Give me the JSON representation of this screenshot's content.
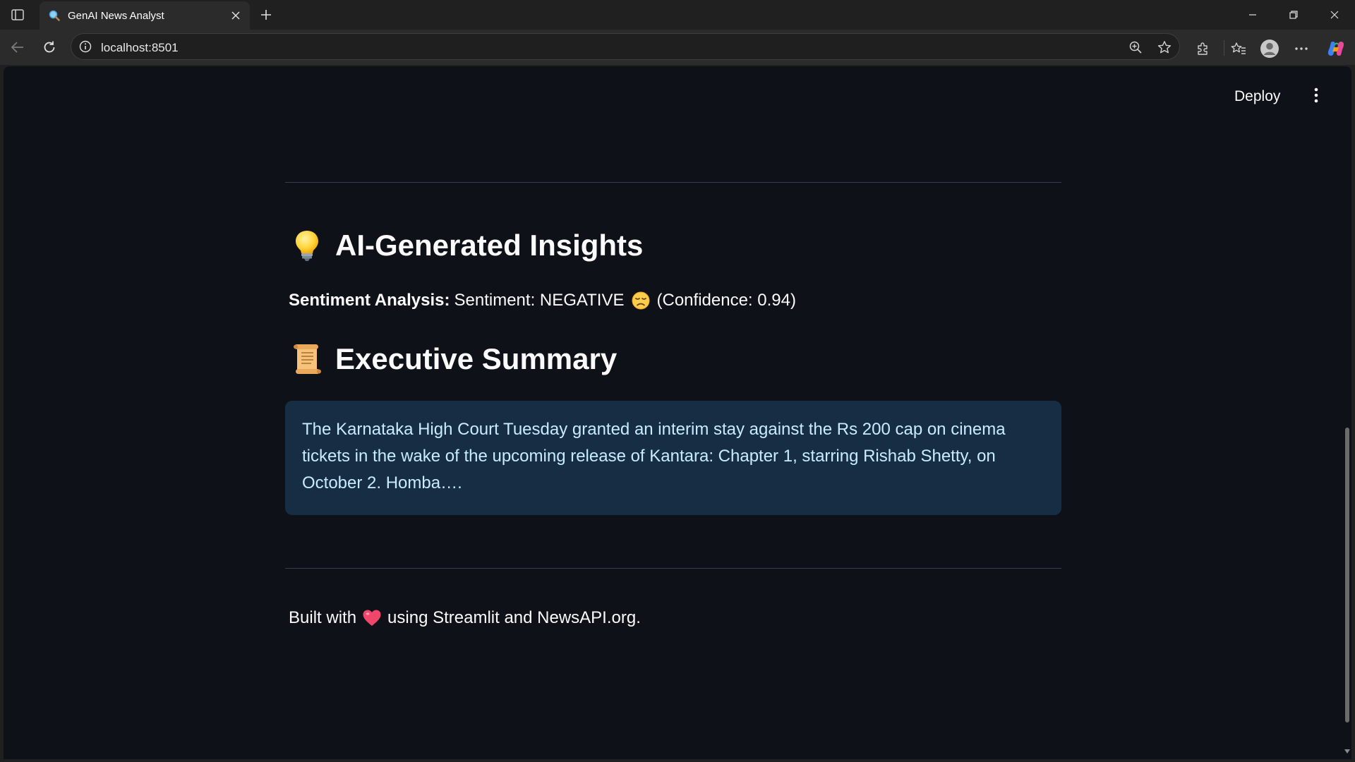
{
  "browser": {
    "tab_title": "GenAI News Analyst",
    "url": "localhost:8501"
  },
  "app": {
    "deploy_label": "Deploy",
    "insights_heading": "AI-Generated Insights",
    "insights_icon": "light-bulb-emoji",
    "sentiment": {
      "label": "Sentiment Analysis:",
      "value": "Sentiment: NEGATIVE",
      "emoji": "disappointed-face-emoji",
      "confidence": "(Confidence: 0.94)"
    },
    "summary_heading": "Executive Summary",
    "summary_icon": "scroll-emoji",
    "summary_text": "The Karnataka High Court Tuesday granted an interim stay against the Rs 200 cap on cinema tickets in the wake of the upcoming release of Kantara: Chapter 1, starring Rishab Shetty, on October 2. Homba….",
    "footer": {
      "prefix": "Built with",
      "icon": "heart-emoji",
      "suffix": "using Streamlit and NewsAPI.org."
    }
  },
  "colors": {
    "page_bg": "#0e1117",
    "summary_bg": "#172d43",
    "summary_text": "#c7ebff",
    "text": "#fafafa"
  }
}
